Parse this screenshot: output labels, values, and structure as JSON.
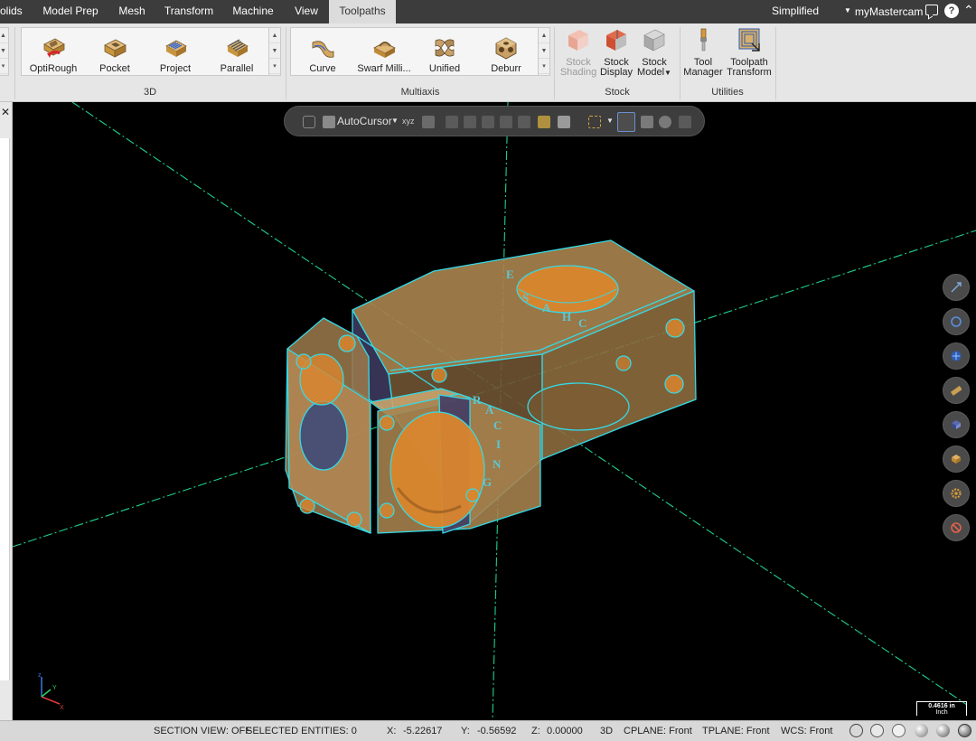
{
  "menu": {
    "tabs": [
      "olids",
      "Model Prep",
      "Mesh",
      "Transform",
      "Machine",
      "View",
      "Toolpaths"
    ],
    "active_tab": "Toolpaths",
    "right_label": "Simplified",
    "account": "myMastercam"
  },
  "ribbon": {
    "group_3d": {
      "label": "3D",
      "buttons": [
        "OptiRough",
        "Pocket",
        "Project",
        "Parallel"
      ]
    },
    "group_multiaxis": {
      "label": "Multiaxis",
      "buttons": [
        "Curve",
        "Swarf Milli...",
        "Unified",
        "Deburr"
      ]
    },
    "group_stock": {
      "label": "Stock",
      "buttons": [
        {
          "line1": "Stock",
          "line2": "Shading",
          "enabled": false
        },
        {
          "line1": "Stock",
          "line2": "Display",
          "enabled": true
        },
        {
          "line1": "Stock",
          "line2": "Model",
          "enabled": true
        }
      ]
    },
    "group_utilities": {
      "label": "Utilities",
      "buttons": [
        {
          "line1": "Tool",
          "line2": "Manager"
        },
        {
          "line1": "Toolpath",
          "line2": "Transform"
        }
      ]
    }
  },
  "floating_toolbar": {
    "autocursor_label": "AutoCursor"
  },
  "part_engraving": [
    "R",
    "A",
    "C",
    "I",
    "N",
    "G",
    "C",
    "H",
    "A",
    "S",
    "E"
  ],
  "scale": {
    "value": "0.4616 in",
    "unit": "Inch"
  },
  "status": {
    "section_view": "SECTION VIEW: OFF",
    "selected": "SELECTED ENTITIES: 0",
    "x_label": "X:",
    "x_value": "-5.22617",
    "y_label": "Y:",
    "y_value": "-0.56592",
    "z_label": "Z:",
    "z_value": "0.00000",
    "mode": "3D",
    "cplane": "CPLANE: Front",
    "tplane": "TPLANE: Front",
    "wcs": "WCS: Front"
  },
  "colors": {
    "axis_green": "#1fd08a",
    "part_fill": "#a9824b",
    "part_edge": "#35d9e6",
    "bore_orange": "#d9862e",
    "active_tab_bg": "#dcdcdc"
  }
}
